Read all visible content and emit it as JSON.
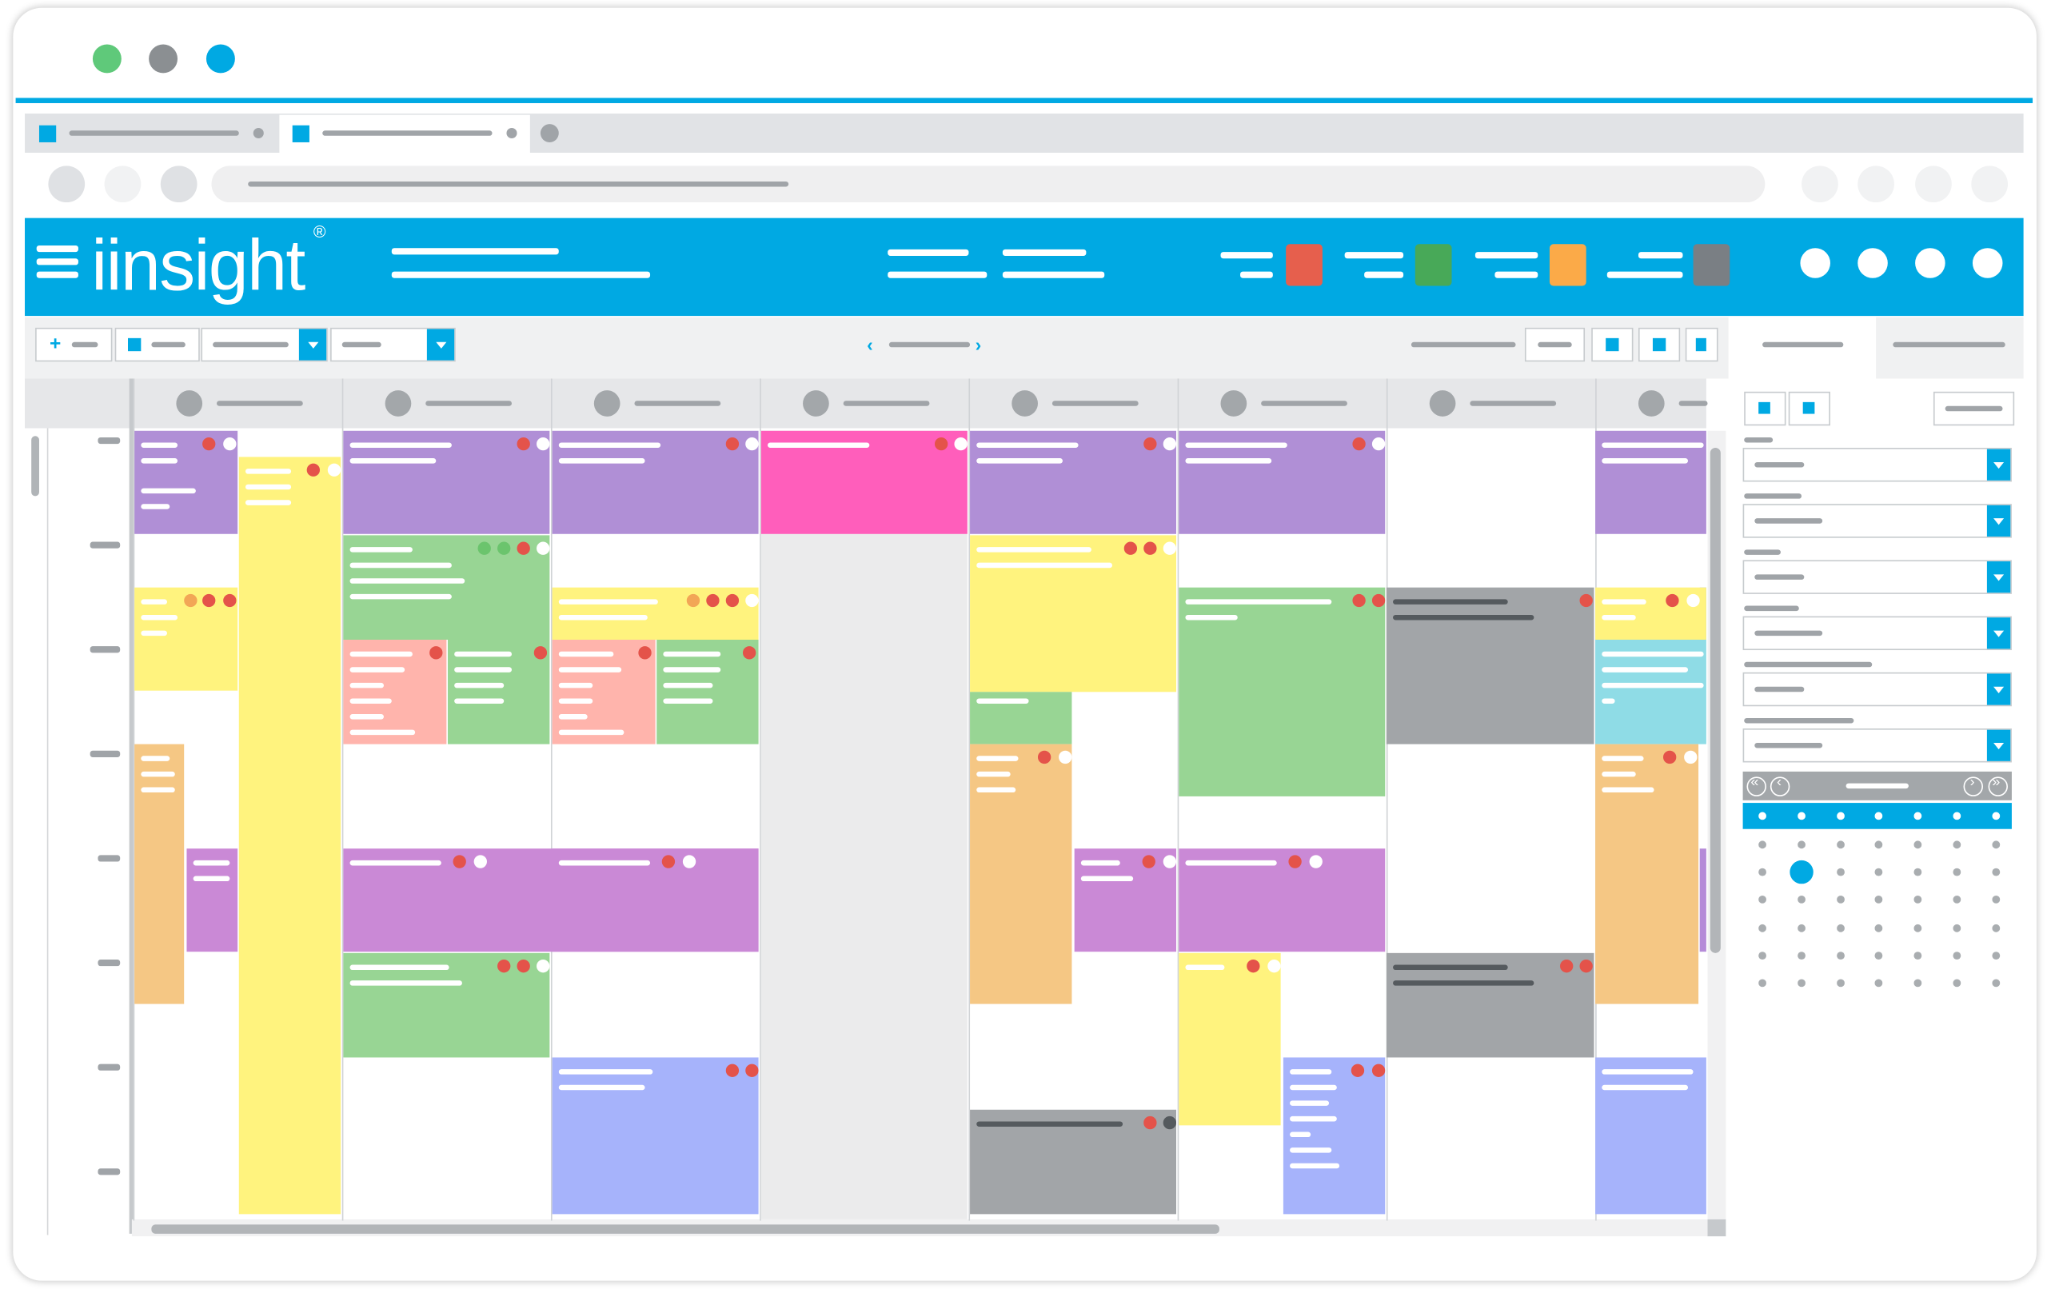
{
  "app": {
    "logo_text": "iinsight",
    "logo_mark": "®"
  },
  "window": {
    "controls": [
      "green-dot",
      "gray-dot",
      "blue-dot"
    ]
  },
  "colors": {
    "accent": "#00a9e3",
    "purple": "#b08fd6",
    "yellow": "#fff37e",
    "green": "#98d594",
    "pink": "#ff5ebb",
    "salmon": "#ffb4ac",
    "grey": "#a2a5a8",
    "orange": "#f5c784",
    "violet": "#ca89d6",
    "periwinkle": "#a6b3fb",
    "cyan": "#8fdce6"
  },
  "header": {
    "legend_swatches": [
      "#e65f4d",
      "#48a958",
      "#fbaa48",
      "#7a7f84"
    ]
  },
  "icons": {
    "menu": "hamburger-icon",
    "add": "plus-icon",
    "prev": "chevron-left-icon",
    "next": "chevron-right-icon",
    "dropdown": "caret-down-icon",
    "cal_prev_year": "double-chevron-left-icon",
    "cal_prev": "chevron-left-circle-icon",
    "cal_next": "chevron-right-circle-icon",
    "cal_next_year": "double-chevron-right-icon"
  }
}
